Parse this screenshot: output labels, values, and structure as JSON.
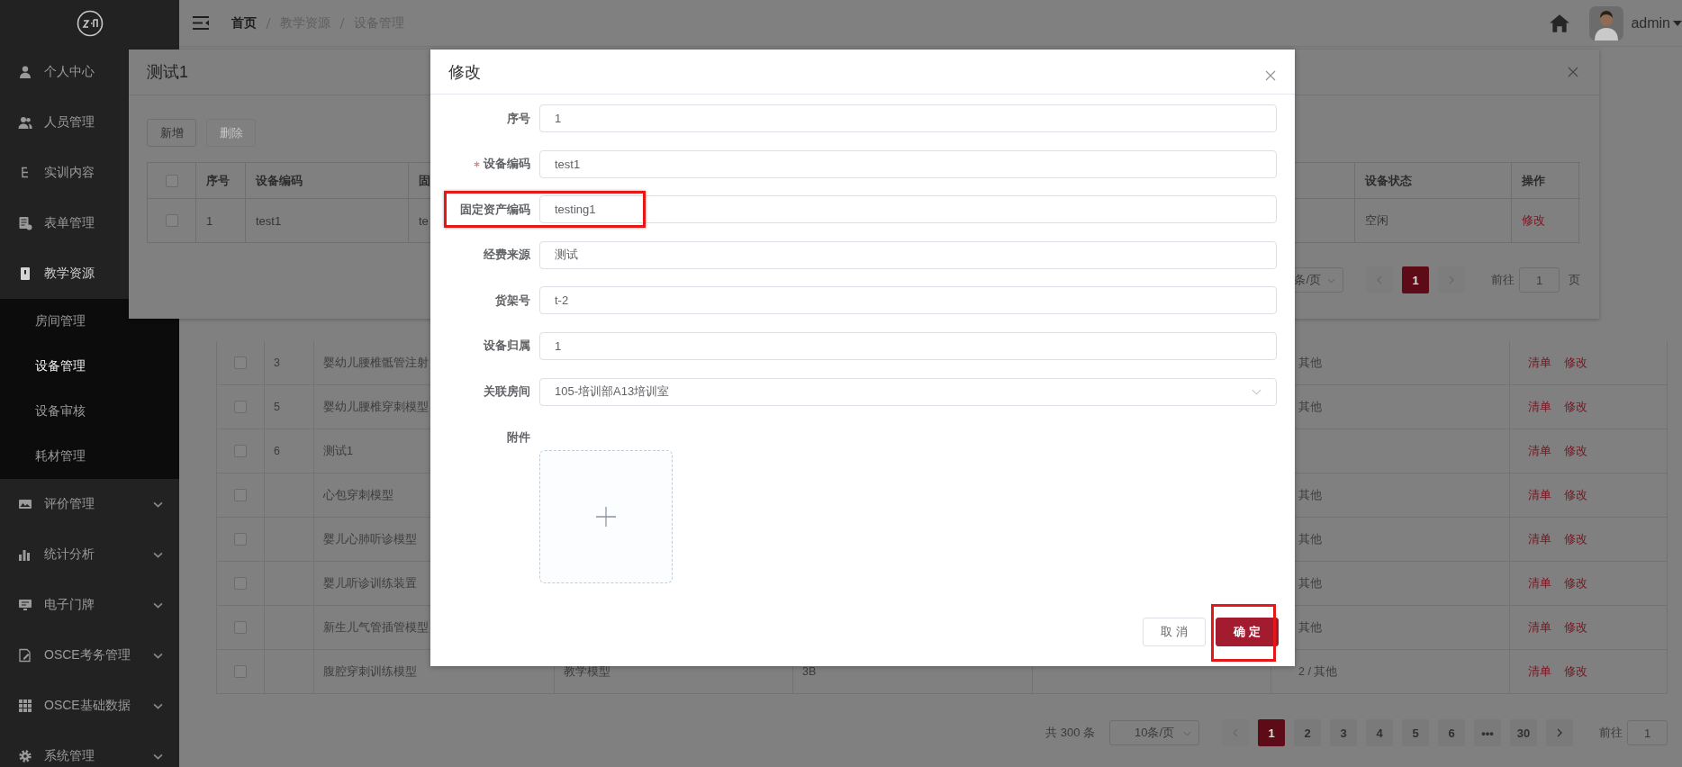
{
  "sidebar": {
    "items": [
      {
        "label": "个人中心",
        "expandable": false,
        "expanded": false
      },
      {
        "label": "人员管理",
        "expandable": false,
        "expanded": false
      },
      {
        "label": "实训内容",
        "expandable": false,
        "expanded": false
      },
      {
        "label": "表单管理",
        "expandable": false,
        "expanded": false
      },
      {
        "label": "教学资源",
        "expandable": false,
        "expanded": true,
        "children": [
          {
            "label": "房间管理",
            "selected": false
          },
          {
            "label": "设备管理",
            "selected": true
          },
          {
            "label": "设备审核",
            "selected": false
          },
          {
            "label": "耗材管理",
            "selected": false
          }
        ]
      },
      {
        "label": "评价管理",
        "expandable": true,
        "expanded": false
      },
      {
        "label": "统计分析",
        "expandable": true,
        "expanded": false
      },
      {
        "label": "电子门牌",
        "expandable": true,
        "expanded": false
      },
      {
        "label": "OSCE考务管理",
        "expandable": true,
        "expanded": false
      },
      {
        "label": "OSCE基础数据",
        "expandable": true,
        "expanded": false
      },
      {
        "label": "系统管理",
        "expandable": true,
        "expanded": false
      }
    ]
  },
  "header": {
    "breadcrumb": [
      "首页",
      "教学资源",
      "设备管理"
    ],
    "user": "admin"
  },
  "table": {
    "rows": [
      {
        "checked": false,
        "index": "3",
        "name": "婴幼儿腰椎骶管注射",
        "status": "其他",
        "actions": [
          "清单",
          "修改"
        ]
      },
      {
        "checked": false,
        "index": "5",
        "name": "婴幼儿腰椎穿刺模型",
        "status": "其他",
        "actions": [
          "清单",
          "修改"
        ]
      },
      {
        "checked": false,
        "index": "6",
        "name": "测试1",
        "actions": [
          "清单",
          "修改"
        ]
      },
      {
        "checked": false,
        "name": "心包穿刺模型",
        "status": "其他",
        "actions": [
          "清单",
          "修改"
        ]
      },
      {
        "checked": false,
        "name": "婴儿心肺听诊模型",
        "status": "其他",
        "actions": [
          "清单",
          "修改"
        ]
      },
      {
        "checked": false,
        "name": "婴儿听诊训练装置",
        "status": "其他",
        "actions": [
          "清单",
          "修改"
        ]
      },
      {
        "checked": false,
        "name": "新生儿气管插管模型",
        "status": "其他",
        "actions": [
          "清单",
          "修改"
        ]
      },
      {
        "checked": false,
        "name": "腹腔穿刺训练模型",
        "type": "教学模型",
        "model": "3B",
        "status": "2 / 其他",
        "actions": [
          "清单",
          "修改"
        ]
      }
    ]
  },
  "pagination": {
    "total": "共 300 条",
    "page_size": "10条/页",
    "pages": [
      {
        "label": "1",
        "selected": true
      },
      {
        "label": "2",
        "selected": false
      },
      {
        "label": "3",
        "selected": false
      },
      {
        "label": "4",
        "selected": false
      },
      {
        "label": "5",
        "selected": false
      },
      {
        "label": "6",
        "selected": false
      },
      {
        "label": "•••",
        "selected": false
      },
      {
        "label": "30",
        "selected": false
      }
    ],
    "goto_label": "前往",
    "goto_value": "1"
  },
  "list_dialog": {
    "title": "测试1",
    "buttons": [
      {
        "label": "新增",
        "disabled": false
      },
      {
        "label": "删除",
        "disabled": true
      }
    ],
    "all_checked": false,
    "columns": [
      "序号",
      "设备编码",
      "固",
      "设备状态",
      "操作"
    ],
    "rows": [
      {
        "checked": false,
        "cells": [
          "1",
          "test1",
          "te",
          "空闲"
        ],
        "action": "修改"
      }
    ],
    "pagination": {
      "page_size": "条/页",
      "pages": [
        {
          "label": "1",
          "selected": true
        }
      ],
      "goto_label": "前往",
      "goto_value": "1",
      "goto_suffix": "页"
    }
  },
  "edit_dialog": {
    "title": "修改",
    "fields": [
      {
        "kind": "input",
        "label": "序号",
        "value": "1",
        "required": false,
        "highlighted": false
      },
      {
        "kind": "input",
        "label": "设备编码",
        "value": "test1",
        "required": true,
        "highlighted": false
      },
      {
        "kind": "input",
        "label": "固定资产编码",
        "value": "testing1",
        "required": false,
        "highlighted": true
      },
      {
        "kind": "input",
        "label": "经费来源",
        "value": "测试",
        "required": false,
        "highlighted": false
      },
      {
        "kind": "input",
        "label": "货架号",
        "value": "t-2",
        "required": false,
        "highlighted": false
      },
      {
        "kind": "input",
        "label": "设备归属",
        "value": "1",
        "required": false,
        "highlighted": false
      },
      {
        "kind": "select",
        "label": "关联房间",
        "value": "105-培训部A13培训室",
        "required": false,
        "highlighted": false
      },
      {
        "kind": "upload",
        "label": "附件",
        "required": false,
        "highlighted": false
      }
    ],
    "buttons": [
      {
        "kind": "default",
        "label": "取消",
        "highlighted": false
      },
      {
        "kind": "primary",
        "label": "确定",
        "highlighted": true
      }
    ]
  }
}
